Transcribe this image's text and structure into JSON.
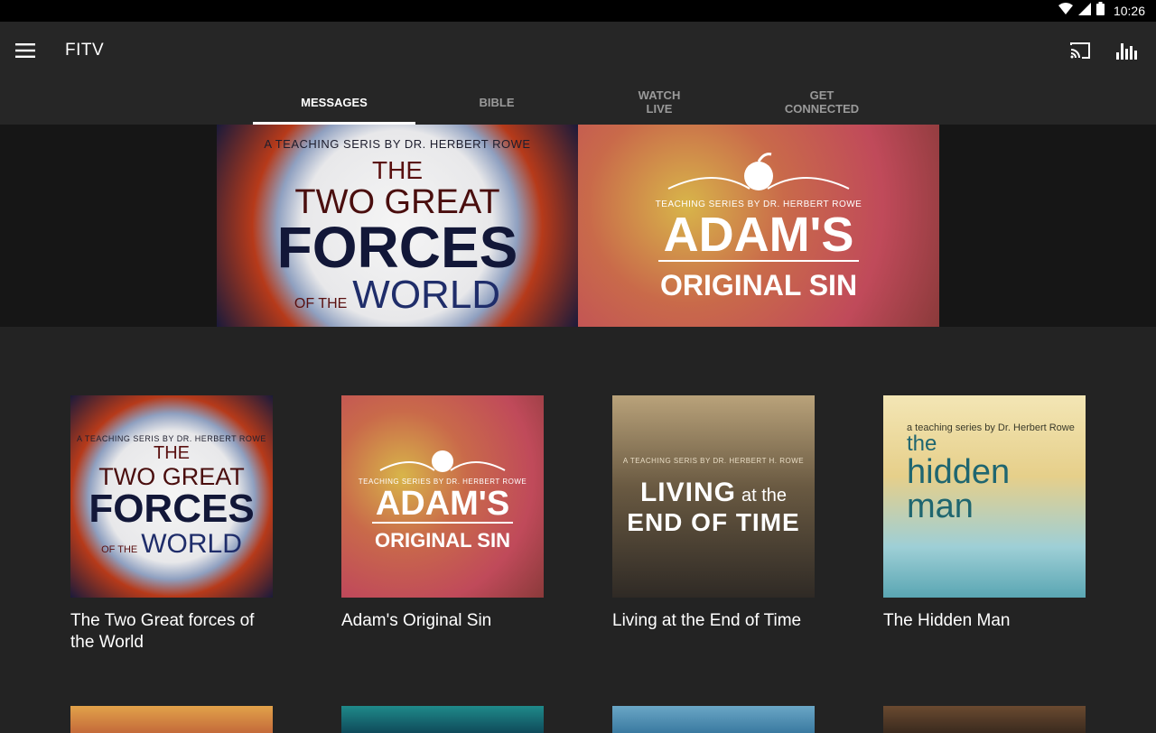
{
  "status": {
    "time": "10:26"
  },
  "appbar": {
    "title": "FITV"
  },
  "tabs": [
    {
      "label": "MESSAGES"
    },
    {
      "label": "BIBLE"
    },
    {
      "label": "WATCH\nLIVE"
    },
    {
      "label": "GET\nCONNECTED"
    }
  ],
  "hero": {
    "slide1": {
      "line1": "A TEACHING SERIS BY DR. HERBERT ROWE",
      "line2": "THE",
      "line3": "TWO GREAT",
      "line4": "FORCES",
      "line5": "OF THE",
      "line6": "WORLD"
    },
    "slide2": {
      "line1": "TEACHING SERIES BY DR. HERBERT ROWE",
      "line2": "ADAM'S",
      "line3": "ORIGINAL SIN"
    }
  },
  "cards": [
    {
      "caption": "The Two Great forces of the World",
      "art": {
        "a": "A TEACHING SERIS BY DR. HERBERT ROWE",
        "b": "THE",
        "c": "TWO GREAT",
        "d": "FORCES",
        "e": "OF THE",
        "f": "WORLD"
      }
    },
    {
      "caption": "Adam's Original Sin",
      "art": {
        "a": "TEACHING SERIES BY DR. HERBERT ROWE",
        "b": "ADAM'S",
        "c": "ORIGINAL SIN"
      }
    },
    {
      "caption": "Living at the End of Time",
      "art": {
        "a": "A TEACHING SERIS BY DR. HERBERT H. ROWE",
        "b": "LIVING",
        "c": "at the",
        "d": "END OF TIME"
      }
    },
    {
      "caption": "The Hidden Man",
      "art": {
        "a": "a teaching series by Dr. Herbert Rowe",
        "b": "the",
        "c": "hidden",
        "d": "man"
      }
    }
  ]
}
